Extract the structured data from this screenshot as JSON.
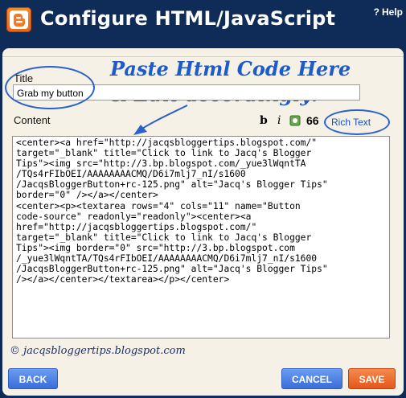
{
  "header": {
    "title": "Configure HTML/JavaScript",
    "help": "Help",
    "help_icon": "question-icon"
  },
  "annotation": {
    "line1": "Paste Html Code Here",
    "line2": "& Edit accordingly!",
    "color": "#1f5bc8"
  },
  "form": {
    "title_label": "Title",
    "title_value": "Grab my button",
    "content_label": "Content"
  },
  "toolbar": {
    "bold_label": "b",
    "italic_label": "i",
    "image_icon": "image-icon",
    "quote_label": "66",
    "rich_text_label": "Rich Text"
  },
  "editor": {
    "lines": [
      "<center><a href=\"http://jacqsbloggertips.blogspot.com/\"",
      "target=\"_blank\" title=\"Click to link to Jacq's Blogger",
      "Tips\"><img src=\"http://3.bp.blogspot.com/_yue3lWqntTA",
      "/TQs4rFIbOEI/AAAAAAAACMQ/D6i7mlj7_nI/s1600",
      "/JacqsBloggerButton+rc-125.png\" alt=\"Jacq's Blogger Tips\"",
      "border=\"0\" /></a></center>",
      "<center><p><textarea rows=\"4\" cols=\"11\" name=\"Button",
      "code-source\" readonly=\"readonly\"><center><a",
      "href=\"http://jacqsbloggertips.blogspot.com/\"",
      "target=\"_blank\" title=\"Click to link to Jacq's Blogger",
      "Tips\"><img border=\"0\" src=\"http://3.bp.blogspot.com",
      "/_yue3lWqntTA/TQs4rFIbOEI/AAAAAAAACMQ/D6i7mlj7_nI/s1600",
      "/JacqsBloggerButton+rc-125.png\" alt=\"Jacq's Blogger Tips\"",
      "/></a></center></textarea></p></center>"
    ]
  },
  "footer": {
    "copyright": "© jacqsbloggertips.blogspot.com",
    "back_label": "BACK",
    "cancel_label": "CANCEL",
    "save_label": "SAVE"
  },
  "colors": {
    "header_bg": "#0f2b57",
    "panel_bg": "#f5f1e6",
    "button_blue": "#3a6ed8",
    "button_orange": "#e5561c"
  }
}
